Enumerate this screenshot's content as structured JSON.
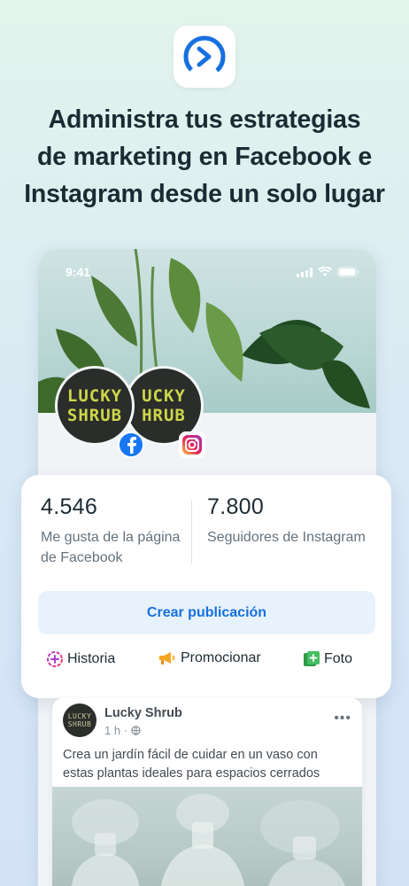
{
  "headline": {
    "line1": "Administra tus estrategias",
    "line2": "de marketing en Facebook e",
    "line3": "Instagram desde un solo lugar"
  },
  "phone": {
    "status_time": "9:41"
  },
  "profile": {
    "logo_line1": "LUCKY",
    "logo_line2": "SHRUB",
    "logo_back_line1": "UCKY",
    "logo_back_line2": "HRUB"
  },
  "stats": {
    "facebook_likes": "4.546",
    "facebook_likes_label": "Me gusta de la página de Facebook",
    "instagram_followers": "7.800",
    "instagram_followers_label": "Seguidores de Instagram"
  },
  "actions": {
    "create_post": "Crear publicación",
    "story": "Historia",
    "promote": "Promocionar",
    "photo": "Foto"
  },
  "post": {
    "page_name": "Lucky Shrub",
    "time": "1 h ·",
    "text": "Crea un jardín fácil de cuidar en un vaso con estas plantas ideales para espacios cerrados",
    "avatar_line1": "LUCKY",
    "avatar_line2": "SHRUB",
    "menu": "•••"
  },
  "colors": {
    "accent": "#1670e0",
    "facebook_blue": "#1877f2",
    "logo_yellow": "#cdd64a"
  }
}
